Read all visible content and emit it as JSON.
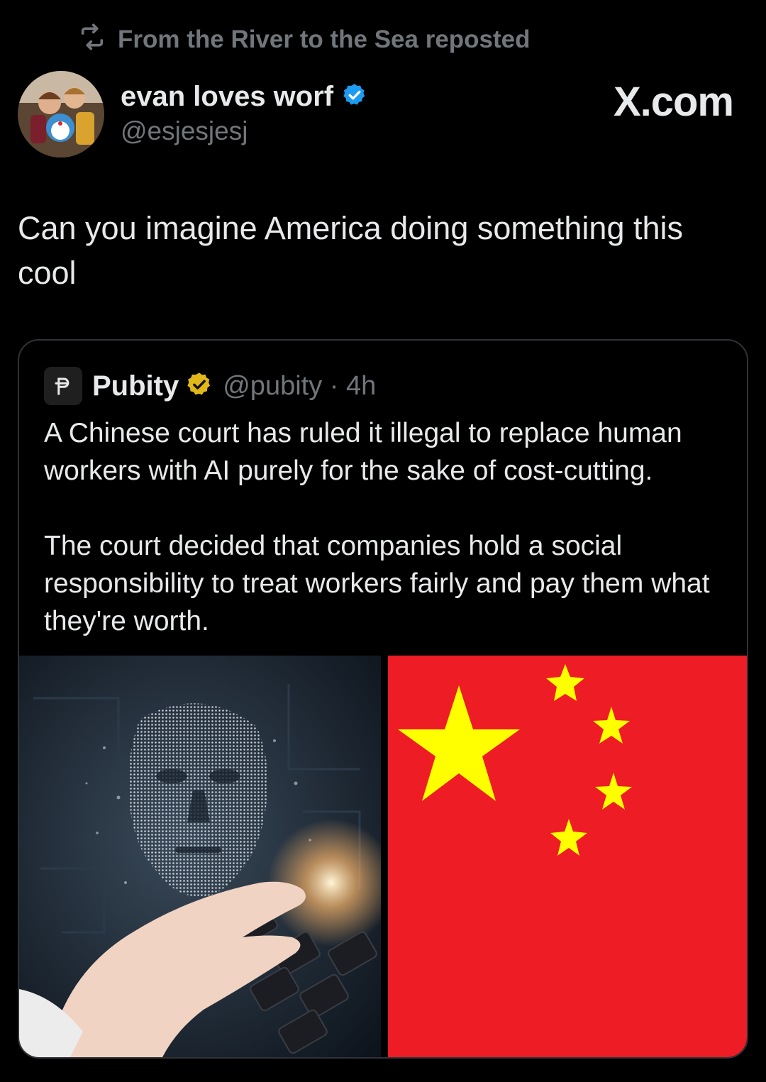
{
  "repost": {
    "icon": "repost-icon",
    "label": "From the River to the Sea reposted"
  },
  "author": {
    "display_name": "evan loves worf",
    "verified_icon": "verified-badge-icon",
    "verified_color": "#1d9bf0",
    "handle": "@esjesjesj"
  },
  "watermark": "X.com",
  "post": {
    "text": "Can you imagine America doing something this cool"
  },
  "quote": {
    "logo_icon": "pubity-logo-icon",
    "name": "Pubity",
    "verified_icon": "gold-verified-badge-icon",
    "verified_color": "#e2b719",
    "handle_time": "@pubity · 4h",
    "paragraph1": "A Chinese court has ruled it illegal to replace human workers with AI purely for the sake of cost-cutting.",
    "paragraph2": "The court decided that companies hold a social responsibility to treat workers fairly and pay them what they're worth."
  },
  "media": {
    "left_image": "digital-ai-face-keyboard-image",
    "right_image": "china-flag-image",
    "flag_red": "#ee1c25",
    "flag_yellow": "#ffff00"
  },
  "colors": {
    "background": "#000000",
    "text_primary": "#e7e9ea",
    "text_secondary": "#71767b",
    "border": "#2f3336"
  }
}
